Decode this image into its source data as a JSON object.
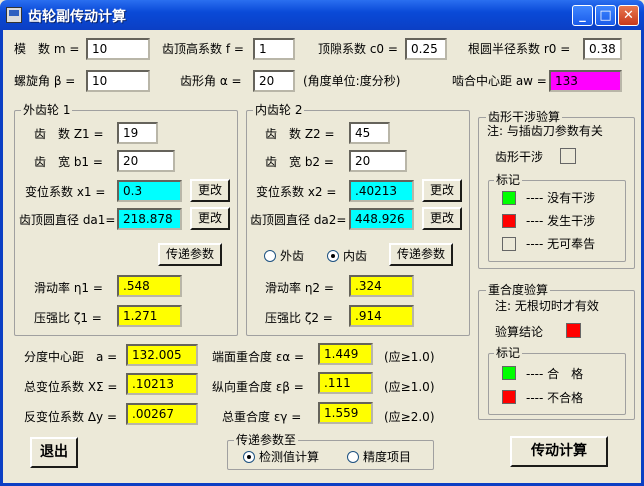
{
  "window": {
    "title": "齿轮副传动计算"
  },
  "params": {
    "module_label": "模　数 m =",
    "module_value": "10",
    "addendum_label": "齿顶高系数 f =",
    "addendum_value": "1",
    "clearance_label": "顶隙系数 c0 =",
    "clearance_value": "0.25",
    "root_radius_label": "根圆半径系数 r0 =",
    "root_radius_value": "0.38",
    "helix_label": "螺旋角 β =",
    "helix_value": "10",
    "profile_label": "齿形角 α =",
    "profile_value": "20",
    "unit_note": "(角度单位:度分秒)",
    "center_label": "啮合中心距 aw =",
    "center_value": "133"
  },
  "gear1": {
    "title": "外齿轮 1",
    "teeth_label": "齿　数 Z1 =",
    "teeth_value": "19",
    "width_label": "齿　宽 b1 =",
    "width_value": "20",
    "shift_label": "变位系数 x1 =",
    "shift_value": "0.3",
    "shift_btn": "更改",
    "tip_label": "齿顶圆直径 da1=",
    "tip_value": "218.878",
    "tip_btn": "更改",
    "pass_btn": "传递参数",
    "slide_label": "滑动率 η1 =",
    "slide_value": ".548",
    "press_label": "压强比 ζ1 =",
    "press_value": "1.271"
  },
  "gear2": {
    "title": "内齿轮 2",
    "teeth_label": "齿　数 Z2 =",
    "teeth_value": "45",
    "width_label": "齿　宽 b2 =",
    "width_value": "20",
    "shift_label": "变位系数 x2 =",
    "shift_value": ".40213",
    "shift_btn": "更改",
    "tip_label": "齿顶圆直径 da2=",
    "tip_value": "448.926",
    "tip_btn": "更改",
    "radio_external": "外齿",
    "radio_internal": "内齿",
    "pass_btn": "传递参数",
    "slide_label": "滑动率 η2 =",
    "slide_value": ".324",
    "press_label": "压强比 ζ2 =",
    "press_value": ".914"
  },
  "interference": {
    "title": "齿形干涉验算",
    "note": "注: 与插齿刀参数有关",
    "check_label": "齿形干涉",
    "legend_title": "标记",
    "legend": [
      {
        "text": "---- 没有干涉",
        "color": "#00ff00"
      },
      {
        "text": "---- 发生干涉",
        "color": "#ff0000"
      },
      {
        "text": "---- 无可奉告",
        "color": "#ece9d8"
      }
    ]
  },
  "overlap": {
    "title": "重合度验算",
    "note": "注: 无根切时才有效",
    "result_label": "验算结论",
    "result_color": "#ff0000",
    "legend_title": "标记",
    "legend": [
      {
        "text": "---- 合　格",
        "color": "#00ff00"
      },
      {
        "text": "---- 不合格",
        "color": "#ff0000"
      }
    ]
  },
  "results": {
    "pitch_center_label": "分度中心距　a =",
    "pitch_center_value": "132.005",
    "sum_shift_label": "总变位系数 XΣ =",
    "sum_shift_value": ".10213",
    "back_shift_label": "反变位系数 Δy =",
    "back_shift_value": ".00267",
    "face_label": "端面重合度 εα =",
    "face_value": "1.449",
    "face_req": "(应≥1.0)",
    "axial_label": "纵向重合度 εβ =",
    "axial_value": ".111",
    "axial_req": "(应≥1.0)",
    "total_label": "总重合度 εγ =",
    "total_value": "1.559",
    "total_req": "(应≥2.0)"
  },
  "pass_to": {
    "title": "传递参数至",
    "opt1": "检测值计算",
    "opt2": "精度项目"
  },
  "buttons": {
    "exit": "退出",
    "compute": "传动计算"
  }
}
